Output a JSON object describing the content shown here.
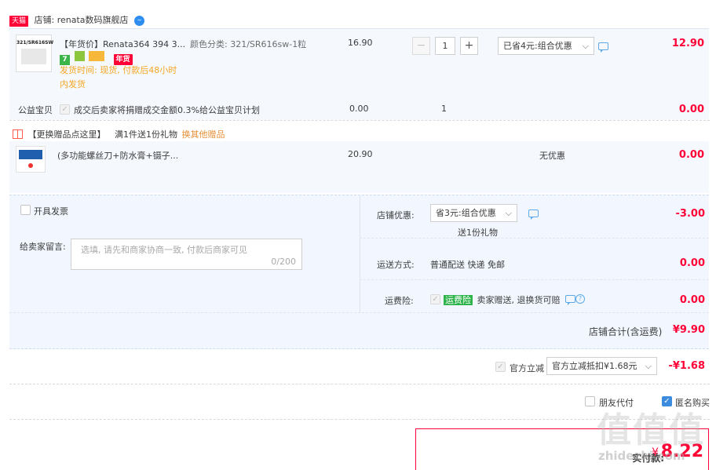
{
  "shop": {
    "badge": "天猫",
    "label": "店铺: renata数码旗舰店"
  },
  "item1": {
    "thumb_text": "321/SR616SW",
    "title": "【年货价】Renata364 394 3...",
    "spec": "颜色分类: 321/SR616sw-1粒",
    "tag_nian": "年货",
    "ship": "发货时间: 现货, 付款后48小时",
    "ship2": "内发货",
    "price": "16.90",
    "qty": "1",
    "minus": "−",
    "plus": "+",
    "promo_select": "已省4元:组合优惠",
    "subtotal": "12.90"
  },
  "charity": {
    "label": "公益宝贝",
    "desc": "成交后卖家将捐赠成交金额0.3%给公益宝贝计划",
    "price": "0.00",
    "qty": "1",
    "subtotal": "0.00"
  },
  "gift": {
    "header": "【更换赠品点这里】",
    "rule": "满1件送1份礼物",
    "change_link": "换其他赠品",
    "title": "(多功能螺丝刀+防水膏+镊子...",
    "price": "20.90",
    "promo": "无优惠",
    "subtotal": "0.00"
  },
  "invoice": {
    "label": "开具发票"
  },
  "message": {
    "label": "给卖家留言:",
    "placeholder": "选填, 请先和商家协商一致, 付款后商家可见",
    "counter": "0/200"
  },
  "shop_promo": {
    "label": "店铺优惠:",
    "select": "省3元:组合优惠",
    "sub": "送1份礼物",
    "amount": "-3.00"
  },
  "shipping": {
    "label": "运送方式:",
    "value": "普通配送 快递 免邮",
    "amount": "0.00"
  },
  "insurance": {
    "label": "运费险:",
    "badge": "运费险",
    "desc": "卖家赠送, 退换货可赔",
    "amount": "0.00"
  },
  "shop_total": {
    "label": "店铺合计(含运费)",
    "amount": "¥9.90"
  },
  "official": {
    "label": "官方立减",
    "select": "官方立减抵扣¥1.68元",
    "amount": "-¥1.68"
  },
  "friend_pay": {
    "label": "朋友代付"
  },
  "anonymous": {
    "label": "匿名购买"
  },
  "pay": {
    "label": "实付款:",
    "currency": "¥",
    "amount": "8.22"
  },
  "watermark": {
    "big": "值值值",
    "url": "zhidezhi.com"
  },
  "colors": {
    "accent_red": "#ff0036",
    "light_blue_bg": "#f2f7ff",
    "orange": "#f5a623"
  }
}
